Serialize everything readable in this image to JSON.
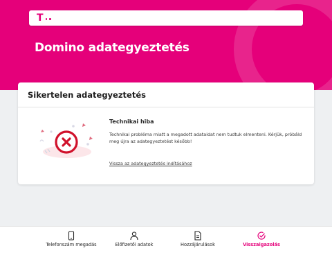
{
  "header": {
    "logo_icon": "telekom-logo-icon",
    "page_title": "Domino adategyeztetés"
  },
  "card": {
    "title": "Sikertelen adategyeztetés",
    "illustration_icon": "error-x-icon",
    "message_title": "Technikai hiba",
    "message_text": "Technikai probléma miatt a megadott adataidat nem tudtuk elmenteni. Kérjük, próbáld meg újra az adategyeztetést később!",
    "retry_link": "Vissza az adategyeztetés indításához"
  },
  "stepper": {
    "steps": [
      {
        "label": "Telefonszám megadás",
        "icon": "phone-icon",
        "active": false
      },
      {
        "label": "Előfizetői adatok",
        "icon": "user-icon",
        "active": false
      },
      {
        "label": "Hozzájárulások",
        "icon": "document-icon",
        "active": false
      },
      {
        "label": "Visszaigazolás",
        "icon": "check-circle-icon",
        "active": true
      }
    ]
  },
  "colors": {
    "brand": "#e5007a",
    "error": "#d0112b",
    "background": "#eef0f2"
  }
}
